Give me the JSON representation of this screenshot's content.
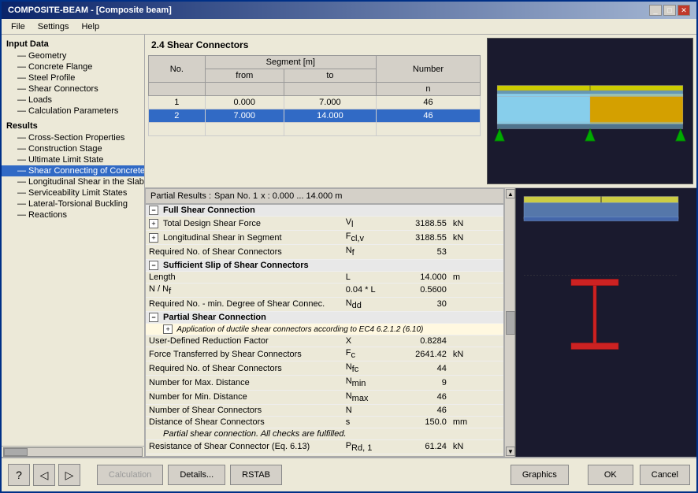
{
  "window": {
    "title": "COMPOSITE-BEAM - [Composite beam]",
    "titlebar_buttons": [
      "_",
      "□",
      "✕"
    ]
  },
  "menu": {
    "items": [
      "File",
      "Settings",
      "Help"
    ]
  },
  "left_panel": {
    "input_data_header": "Input Data",
    "tree_items_input": [
      {
        "label": "Geometry",
        "indent": 1,
        "selected": false
      },
      {
        "label": "Concrete Flange",
        "indent": 1,
        "selected": false
      },
      {
        "label": "Steel Profile",
        "indent": 1,
        "selected": false
      },
      {
        "label": "Shear Connectors",
        "indent": 1,
        "selected": false
      },
      {
        "label": "Loads",
        "indent": 1,
        "selected": false
      },
      {
        "label": "Calculation Parameters",
        "indent": 1,
        "selected": false
      }
    ],
    "results_header": "Results",
    "tree_items_results": [
      {
        "label": "Cross-Section Properties",
        "indent": 1,
        "selected": false
      },
      {
        "label": "Construction Stage",
        "indent": 1,
        "selected": false
      },
      {
        "label": "Ultimate Limit State",
        "indent": 1,
        "selected": false
      },
      {
        "label": "Shear Connecting of Concrete Flange",
        "indent": 1,
        "selected": true
      },
      {
        "label": "Longitudinal Shear in the Slab",
        "indent": 1,
        "selected": false
      },
      {
        "label": "Serviceability Limit States",
        "indent": 1,
        "selected": false
      },
      {
        "label": "Lateral-Torsional Buckling",
        "indent": 1,
        "selected": false
      },
      {
        "label": "Reactions",
        "indent": 1,
        "selected": false
      }
    ]
  },
  "table_section": {
    "title": "2.4 Shear Connectors",
    "columns": {
      "no": "No.",
      "segment_from_label": "Segment [m]",
      "from": "from",
      "to": "to",
      "number_label": "Number",
      "n": "n"
    },
    "rows": [
      {
        "no": 1,
        "from": "0.000",
        "to": "7.000",
        "n": 46,
        "selected": false
      },
      {
        "no": 2,
        "from": "7.000",
        "to": "14.000",
        "n": 46,
        "selected": true
      }
    ]
  },
  "partial_results": {
    "header": "Partial Results :",
    "span_label": "Span No. 1",
    "x_label": "x : 0.000 ... 14.000 m",
    "sections": [
      {
        "type": "section",
        "label": "Full Shear Connection",
        "expanded": true,
        "children": [
          {
            "type": "subsection",
            "label": "Total Design Shear Force",
            "symbol": "Vᴵ",
            "value": "3188.55",
            "unit": "kN"
          },
          {
            "type": "subsection",
            "label": "Longitudinal Shear in Segment",
            "symbol": "Fᴳᴸ,v",
            "value": "3188.55",
            "unit": "kN"
          },
          {
            "type": "item",
            "label": "Required No. of Shear Connectors",
            "symbol": "Nᶠ",
            "value": "53",
            "unit": ""
          }
        ]
      },
      {
        "type": "section",
        "label": "Sufficient Slip of Shear Connectors",
        "expanded": true,
        "children": [
          {
            "type": "item",
            "label": "Length",
            "symbol": "L",
            "value": "14.000",
            "unit": "m"
          },
          {
            "type": "item",
            "label": "N / Nᶠ",
            "symbol": "0.04 * L",
            "value": "0.5600",
            "unit": ""
          },
          {
            "type": "item",
            "label": "Required No. - min. Degree of Shear Connec.",
            "symbol": "Nᵉᵈ",
            "value": "30",
            "unit": ""
          }
        ]
      },
      {
        "type": "section",
        "label": "Partial Shear Connection",
        "expanded": true,
        "children": [
          {
            "type": "info",
            "label": "Application of ductile shear connectors according to EC4 6.2.1.2 (6.10)",
            "symbol": "",
            "value": "",
            "unit": ""
          },
          {
            "type": "item",
            "label": "User-Defined Reduction Factor",
            "symbol": "X",
            "value": "0.8284",
            "unit": ""
          },
          {
            "type": "item",
            "label": "Force Transferred by Shear Connectors",
            "symbol": "Fᴼ",
            "value": "2641.42",
            "unit": "kN"
          },
          {
            "type": "item",
            "label": "Required No. of Shear Connectors",
            "symbol": "Nᶠᴼ",
            "value": "44",
            "unit": ""
          },
          {
            "type": "item",
            "label": "Number for Max. Distance",
            "symbol": "Nᵜᴵⁿ",
            "value": "9",
            "unit": ""
          },
          {
            "type": "item",
            "label": "Number for Min. Distance",
            "symbol": "Nᵜᵃˣ",
            "value": "46",
            "unit": ""
          },
          {
            "type": "item",
            "label": "Number of Shear Connectors",
            "symbol": "N",
            "value": "46",
            "unit": ""
          },
          {
            "type": "item",
            "label": "Distance of Shear Connectors",
            "symbol": "s",
            "value": "150.0",
            "unit": "mm"
          },
          {
            "type": "status",
            "label": "Partial shear connection. All checks are fulfilled.",
            "symbol": "",
            "value": "",
            "unit": ""
          },
          {
            "type": "item",
            "label": "Resistance of Shear Connector (Eq. 6.13)",
            "symbol": "Pᴿᵈ, ₁",
            "value": "61.24",
            "unit": "kN"
          }
        ]
      }
    ]
  },
  "bottom_toolbar": {
    "calculation_label": "Calculation",
    "details_label": "Details...",
    "rstab_label": "RSTAB",
    "graphics_label": "Graphics",
    "ok_label": "OK",
    "cancel_label": "Cancel"
  }
}
